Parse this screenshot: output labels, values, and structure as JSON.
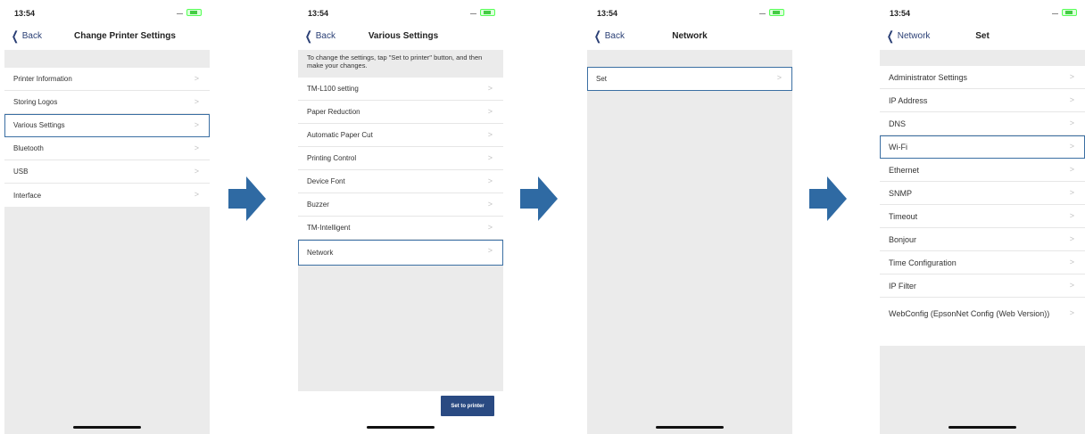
{
  "status_time": "13:54",
  "colors": {
    "accent": "#2a3f75",
    "highlight": "#3b6fa3",
    "arrow": "#2f6aa3",
    "button": "#2a4a82"
  },
  "screens": [
    {
      "back_label": "Back",
      "title": "Change Printer Settings",
      "items": [
        {
          "label": "Printer Information"
        },
        {
          "label": "Storing Logos"
        },
        {
          "label": "Various Settings",
          "highlighted": true
        },
        {
          "label": "Bluetooth"
        },
        {
          "label": "USB"
        },
        {
          "label": "Interface"
        }
      ]
    },
    {
      "back_label": "Back",
      "title": "Various Settings",
      "note": "To change the settings, tap \"Set to printer\" button, and then make your changes.",
      "items": [
        {
          "label": "TM-L100 setting"
        },
        {
          "label": "Paper Reduction"
        },
        {
          "label": "Automatic Paper Cut"
        },
        {
          "label": "Printing Control"
        },
        {
          "label": "Device Font"
        },
        {
          "label": "Buzzer"
        },
        {
          "label": "TM-Intelligent"
        },
        {
          "label": "Network",
          "highlighted": true
        }
      ],
      "button_label": "Set to printer"
    },
    {
      "back_label": "Back",
      "title": "Network",
      "items": [
        {
          "label": "Set",
          "highlighted": true
        }
      ]
    },
    {
      "back_label": "Network",
      "title": "Set",
      "items": [
        {
          "label": "Administrator Settings"
        },
        {
          "label": "IP Address"
        },
        {
          "label": "DNS"
        },
        {
          "label": "Wi-Fi",
          "highlighted": true
        },
        {
          "label": "Ethernet"
        },
        {
          "label": "SNMP"
        },
        {
          "label": "Timeout"
        },
        {
          "label": "Bonjour"
        },
        {
          "label": "Time Configuration"
        },
        {
          "label": "IP Filter"
        },
        {
          "label": "WebConfig (EpsonNet Config (Web Version))"
        }
      ]
    }
  ]
}
